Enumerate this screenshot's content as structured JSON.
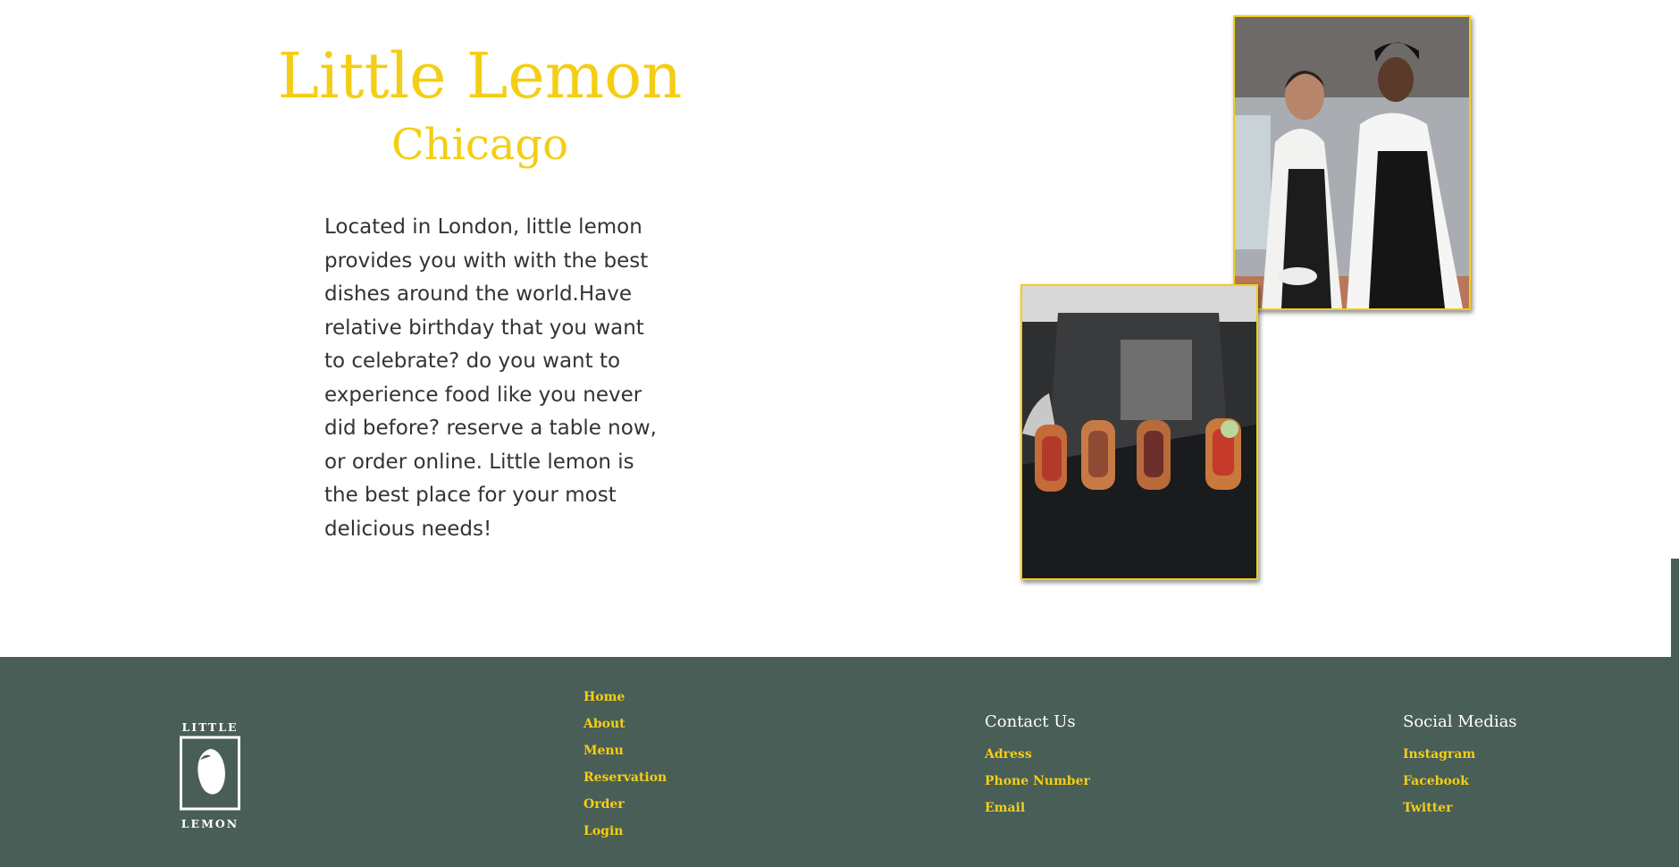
{
  "about": {
    "title": "Little Lemon",
    "subtitle": "Chicago",
    "description": "Located in London, little lemon provides you with with the best dishes around the world.Have relative birthday that you want to celebrate? do you want to experience food like you never did before? reserve a table now, or order online. Little lemon is the best place for your most delicious needs!"
  },
  "footer": {
    "logo_top_text": "LITTLE",
    "logo_bottom_text": "LEMON",
    "nav": [
      "Home",
      "About",
      "Menu",
      "Reservation",
      "Order",
      "Login"
    ],
    "contact": {
      "heading": "Contact Us",
      "links": [
        "Adress",
        "Phone Number",
        "Email"
      ]
    },
    "social": {
      "heading": "Social Medias",
      "links": [
        "Instagram",
        "Facebook",
        "Twitter"
      ]
    }
  },
  "colors": {
    "primary_yellow": "#F4CE14",
    "footer_green": "#495E57",
    "text_dark": "#333333"
  },
  "icons": [
    "little-lemon-logo-icon"
  ]
}
